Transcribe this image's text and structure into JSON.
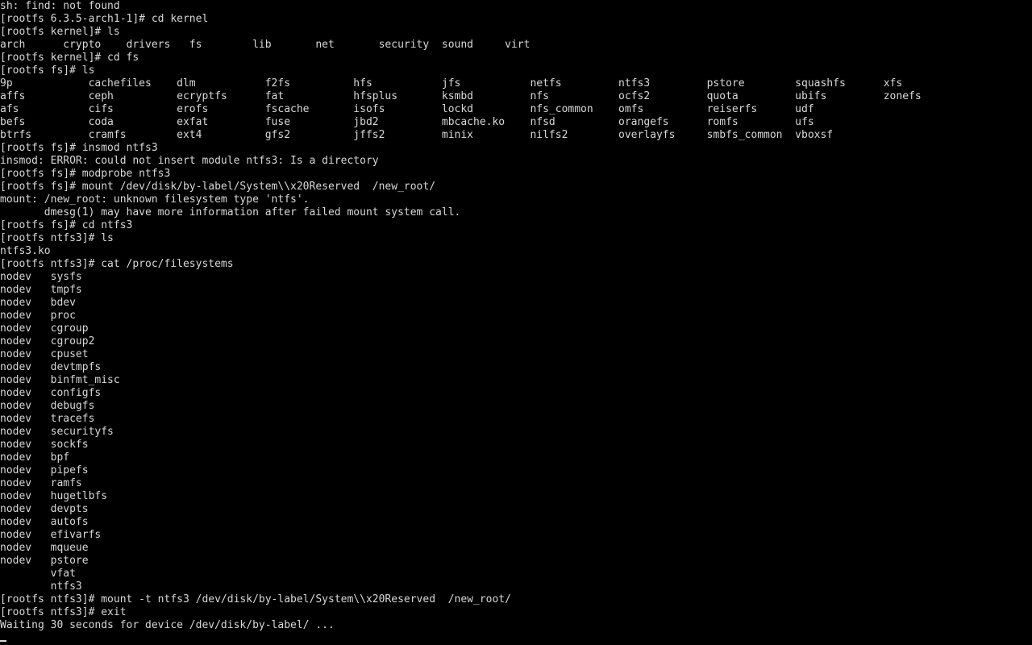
{
  "terminal": {
    "lines": [
      "sh: find: not found",
      "[rootfs 6.3.5-arch1-1]# cd kernel",
      "[rootfs kernel]# ls",
      "arch      crypto    drivers   fs        lib       net       security  sound     virt",
      "[rootfs kernel]# cd fs",
      "[rootfs fs]# ls",
      "9p            cachefiles    dlm           f2fs          hfs           jfs           netfs         ntfs3         pstore        squashfs      xfs",
      "affs          ceph          ecryptfs      fat           hfsplus       ksmbd         nfs           ocfs2         quota         ubifs         zonefs",
      "afs           cifs          erofs         fscache       isofs         lockd         nfs_common    omfs          reiserfs      udf",
      "befs          coda          exfat         fuse          jbd2          mbcache.ko    nfsd          orangefs      romfs         ufs",
      "btrfs         cramfs        ext4          gfs2          jffs2         minix         nilfs2        overlayfs     smbfs_common  vboxsf",
      "[rootfs fs]# insmod ntfs3",
      "insmod: ERROR: could not insert module ntfs3: Is a directory",
      "[rootfs fs]# modprobe ntfs3",
      "[rootfs fs]# mount /dev/disk/by-label/System\\\\x20Reserved  /new_root/",
      "mount: /new_root: unknown filesystem type 'ntfs'.",
      "       dmesg(1) may have more information after failed mount system call.",
      "[rootfs fs]# cd ntfs3",
      "[rootfs ntfs3]# ls",
      "ntfs3.ko",
      "[rootfs ntfs3]# cat /proc/filesystems",
      "nodev   sysfs",
      "nodev   tmpfs",
      "nodev   bdev",
      "nodev   proc",
      "nodev   cgroup",
      "nodev   cgroup2",
      "nodev   cpuset",
      "nodev   devtmpfs",
      "nodev   binfmt_misc",
      "nodev   configfs",
      "nodev   debugfs",
      "nodev   tracefs",
      "nodev   securityfs",
      "nodev   sockfs",
      "nodev   bpf",
      "nodev   pipefs",
      "nodev   ramfs",
      "nodev   hugetlbfs",
      "nodev   devpts",
      "nodev   autofs",
      "nodev   efivarfs",
      "nodev   mqueue",
      "nodev   pstore",
      "        vfat",
      "        ntfs3",
      "[rootfs ntfs3]# mount -t ntfs3 /dev/disk/by-label/System\\\\x20Reserved  /new_root/",
      "[rootfs ntfs3]# exit",
      "Waiting 30 seconds for device /dev/disk/by-label/ ..."
    ]
  }
}
